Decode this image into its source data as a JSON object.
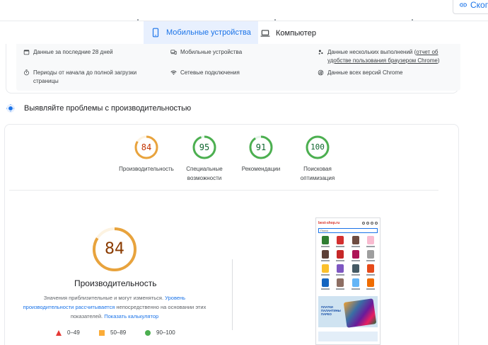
{
  "header": {
    "copy_label": "Скопи"
  },
  "tabs": [
    {
      "label": "Мобильные устройства",
      "icon": "phone-icon",
      "active": true
    },
    {
      "label": "Компьютер",
      "icon": "laptop-icon",
      "active": false
    }
  ],
  "info": {
    "period": "Данные за последние 28 дней",
    "device": "Мобильные устройства",
    "multi_run_prefix": "Данные нескольких выполнений (",
    "multi_run_link": "отчет об удобстве пользования браузером Chrome",
    "multi_run_suffix": ")",
    "load_period": "Периоды от начала до полной загрузки страницы",
    "network": "Сетевые подключения",
    "chrome_versions": "Данные всех версий Chrome"
  },
  "section": {
    "title": "Выявляйте проблемы с производительностью"
  },
  "scores": [
    {
      "value": 84,
      "label": "Производительность",
      "color": "#e8a33d",
      "track": "#fdf3e2"
    },
    {
      "value": 95,
      "label": "Специальные возможности",
      "color": "#4caf50",
      "track": "#e6f4ea"
    },
    {
      "value": 91,
      "label": "Рекомендации",
      "color": "#4caf50",
      "track": "#e6f4ea"
    },
    {
      "value": 100,
      "label": "Поисковая оптимизация",
      "color": "#4caf50",
      "track": "#e6f4ea"
    }
  ],
  "detail": {
    "score": 84,
    "title": "Производительность",
    "note_prefix": "Значения приблизительные и могут изменяться.",
    "note_link1": "Уровень производительности рассчитывается",
    "note_mid": "непосредственно на основании этих показателей.",
    "note_link2": "Показать калькулятор",
    "legend": [
      {
        "range": "0–49",
        "shape": "triangle",
        "color": "#e53935"
      },
      {
        "range": "50–89",
        "shape": "square",
        "color": "#fbac38"
      },
      {
        "range": "90–100",
        "shape": "circle",
        "color": "#4caf50"
      }
    ]
  },
  "phone_preview": {
    "logo": "best-shop.ru",
    "search_placeholder": "Поиск",
    "banner_text": "ПЛАТКИ ПАЛАНТИНЫ ПАРЕО"
  },
  "colors": {
    "accent": "#1a73e8",
    "active_tab_bg": "#e8f0fe",
    "average": "#e8a33d",
    "good": "#4caf50"
  }
}
